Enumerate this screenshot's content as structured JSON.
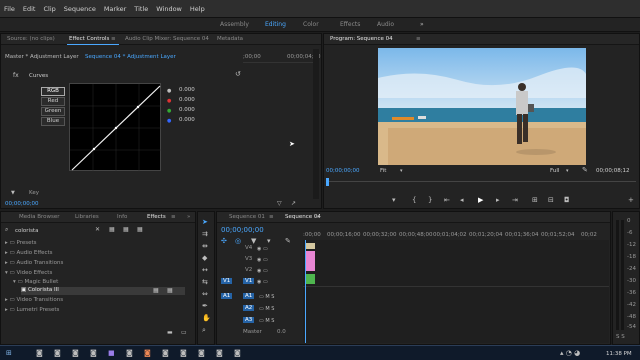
{
  "menu": [
    "File",
    "Edit",
    "Clip",
    "Sequence",
    "Marker",
    "Title",
    "Window",
    "Help"
  ],
  "workspaces": {
    "items": [
      "Assembly",
      "Editing",
      "Color",
      "Effects",
      "Audio"
    ],
    "active": "Editing",
    "more": "»"
  },
  "source_panel": {
    "tabs": [
      "Source: (no clips)",
      "Effect Controls",
      "Audio Clip Mixer: Sequence 04",
      "Metadata"
    ],
    "active_tab": "Effect Controls",
    "master": "Master * Adjustment Layer",
    "sequence": "Sequence 04 * Adjustment Layer",
    "ruler_start": ";00;00",
    "ruler_end": "00;00;04;00",
    "fx_name": "Curves",
    "fx_prefix": "fx",
    "channels": [
      "RGB",
      "Red",
      "Green",
      "Blue"
    ],
    "values": [
      "0.000",
      "0.000",
      "0.000",
      "0.000"
    ],
    "key_label": "Key",
    "timecode": "00;00;00;00"
  },
  "program": {
    "title": "Program: Sequence 04",
    "timecode": "00;00;00;00",
    "fit": "Fit",
    "quality": "Full",
    "duration": "00;00;08;12",
    "buttons": [
      "marker-icon",
      "mark-in-icon",
      "mark-out-icon",
      "go-to-in-icon",
      "step-back-icon",
      "play-icon",
      "step-forward-icon",
      "go-to-out-icon",
      "insert-icon",
      "overwrite-icon",
      "export-frame-icon"
    ]
  },
  "effects_panel": {
    "tabs": [
      "Media Browser",
      "Libraries",
      "Info",
      "Effects"
    ],
    "active_tab": "Effects",
    "search_value": "colorista",
    "tree": [
      {
        "label": "Presets",
        "level": 0,
        "open": false
      },
      {
        "label": "Audio Effects",
        "level": 0,
        "open": false
      },
      {
        "label": "Audio Transitions",
        "level": 0,
        "open": false
      },
      {
        "label": "Video Effects",
        "level": 0,
        "open": true
      },
      {
        "label": "Magic Bullet",
        "level": 1,
        "open": true
      },
      {
        "label": "Colorista III",
        "level": 2,
        "open": false
      },
      {
        "label": "Video Transitions",
        "level": 0,
        "open": false
      },
      {
        "label": "Lumetri Presets",
        "level": 0,
        "open": false
      }
    ]
  },
  "timeline": {
    "tabs": [
      "Sequence 01",
      "Sequence 04"
    ],
    "active_tab": "Sequence 04",
    "timecode": "00;00;00;00",
    "ruler": [
      ":00;00",
      "00;00;16;00",
      "00;00;32;00",
      "00;00;48;00",
      "00;01;04;02",
      "00;01;20;04",
      "00;01;36;04",
      "00;01;52;04",
      "00;02"
    ],
    "video_tracks": [
      "V4",
      "V3",
      "V2",
      "V1"
    ],
    "audio_tracks": [
      "A1",
      "A2",
      "A3"
    ],
    "master_label": "Master",
    "master_value": "0.0",
    "src_v": "V1",
    "src_a": "A1"
  },
  "meter": {
    "labels": [
      "0",
      "-6",
      "-12",
      "-18",
      "-24",
      "-30",
      "-36",
      "-42",
      "-48",
      "-54"
    ],
    "solo": "S S"
  },
  "taskbar": {
    "clock": "11:38 PM"
  }
}
